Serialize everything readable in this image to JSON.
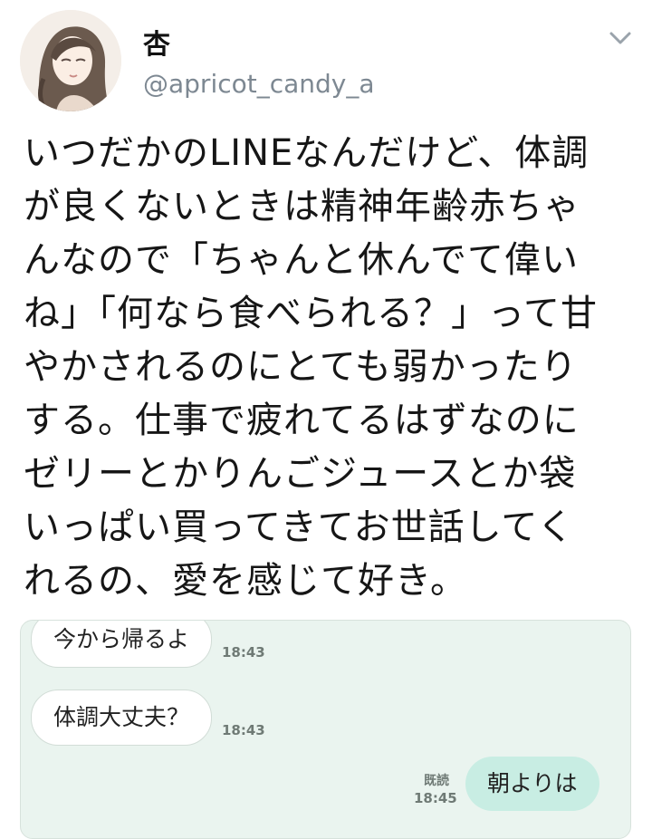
{
  "profile": {
    "display_name": "杏",
    "handle": "@apricot_candy_a",
    "avatar_icon": "portrait-avatar",
    "menu_icon": "chevron-down-icon"
  },
  "tweet": {
    "lines": [
      "いつだかのLINEなんだけど、体調",
      "が良くないときは精神年齢赤ちゃ",
      "んなので「ちゃんと休んでて偉い",
      "ね」「何なら食べられる？」って甘",
      "やかされるのにとても弱かったり",
      "する。仕事で疲れてるはずなのに",
      "ゼリーとかりんごジュースとか袋",
      "いっぱい買ってきてお世話してく",
      "れるの、愛を感じて好き。"
    ]
  },
  "chat": {
    "background_color": "#eaf4ef",
    "messages": [
      {
        "text": "今から帰るよ",
        "time": "18:43",
        "direction": "incoming"
      },
      {
        "text": "体調大丈夫？",
        "time": "18:43",
        "direction": "incoming"
      },
      {
        "text": "朝よりは",
        "time": "18:45",
        "read_label": "既読",
        "direction": "outgoing"
      }
    ]
  }
}
